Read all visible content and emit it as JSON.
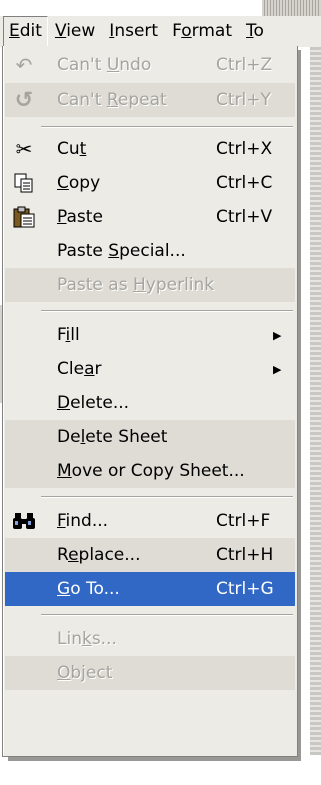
{
  "menubar": {
    "items": [
      {
        "label": "Edit",
        "mnemonic": "E",
        "rest": "dit"
      },
      {
        "label": "View",
        "mnemonic": "V",
        "rest": "iew"
      },
      {
        "label": "Insert",
        "mnemonic": "I",
        "rest": "nsert"
      },
      {
        "pre": "F",
        "mnemonic": "o",
        "rest": "rmat",
        "label": "Format"
      },
      {
        "label": "To",
        "mnemonic": "T",
        "rest": "o"
      }
    ]
  },
  "menu": {
    "items": [
      {
        "pre": "Can't ",
        "mnemonic": "U",
        "rest": "ndo",
        "shortcut": "Ctrl+Z",
        "icon": "undo-icon",
        "glyph": "↶",
        "state": "disabled"
      },
      {
        "pre": "Can't ",
        "mnemonic": "R",
        "rest": "epeat",
        "shortcut": "Ctrl+Y",
        "icon": "repeat-icon",
        "glyph": "↺",
        "state": "disabled"
      },
      {
        "pre": "Cu",
        "mnemonic": "t",
        "rest": "",
        "shortcut": "Ctrl+X",
        "icon": "scissors-icon",
        "glyph": "✂",
        "state": "normal"
      },
      {
        "pre": "",
        "mnemonic": "C",
        "rest": "opy",
        "shortcut": "Ctrl+C",
        "icon": "copy-icon",
        "glyph": "❐",
        "state": "normal"
      },
      {
        "pre": "",
        "mnemonic": "P",
        "rest": "aste",
        "shortcut": "Ctrl+V",
        "icon": "paste-icon",
        "glyph": "📋",
        "state": "normal"
      },
      {
        "pre": "Paste ",
        "mnemonic": "S",
        "rest": "pecial...",
        "shortcut": "",
        "icon": "",
        "glyph": "",
        "state": "normal"
      },
      {
        "pre": "Paste as ",
        "mnemonic": "H",
        "rest": "yperlink",
        "shortcut": "",
        "icon": "",
        "glyph": "",
        "state": "disabled"
      },
      {
        "pre": "F",
        "mnemonic": "i",
        "rest": "ll",
        "shortcut": "",
        "icon": "",
        "glyph": "",
        "state": "normal",
        "submenu": true
      },
      {
        "pre": "Cle",
        "mnemonic": "a",
        "rest": "r",
        "shortcut": "",
        "icon": "",
        "glyph": "",
        "state": "normal",
        "submenu": true
      },
      {
        "pre": "",
        "mnemonic": "D",
        "rest": "elete...",
        "shortcut": "",
        "icon": "",
        "glyph": "",
        "state": "normal"
      },
      {
        "pre": "De",
        "mnemonic": "l",
        "rest": "ete Sheet",
        "shortcut": "",
        "icon": "",
        "glyph": "",
        "state": "shaded"
      },
      {
        "pre": "",
        "mnemonic": "M",
        "rest": "ove or Copy Sheet...",
        "shortcut": "",
        "icon": "",
        "glyph": "",
        "state": "shaded"
      },
      {
        "pre": "",
        "mnemonic": "F",
        "rest": "ind...",
        "shortcut": "Ctrl+F",
        "icon": "binoculars-icon",
        "glyph": "",
        "state": "normal"
      },
      {
        "pre": "R",
        "mnemonic": "e",
        "rest": "place...",
        "shortcut": "Ctrl+H",
        "icon": "",
        "glyph": "",
        "state": "shaded"
      },
      {
        "pre": "",
        "mnemonic": "G",
        "rest": "o To...",
        "shortcut": "Ctrl+G",
        "icon": "",
        "glyph": "",
        "state": "highlighted"
      },
      {
        "pre": "Lin",
        "mnemonic": "k",
        "rest": "s...",
        "shortcut": "",
        "icon": "",
        "glyph": "",
        "state": "disabled"
      },
      {
        "pre": "",
        "mnemonic": "O",
        "rest": "bject",
        "shortcut": "",
        "icon": "",
        "glyph": "",
        "state": "disabled-shaded"
      }
    ]
  },
  "colors": {
    "menu_bg": "#ecebe6",
    "highlight": "#3168c6",
    "disabled_text": "#a6a49e",
    "shaded_row": "#dedcd5"
  }
}
